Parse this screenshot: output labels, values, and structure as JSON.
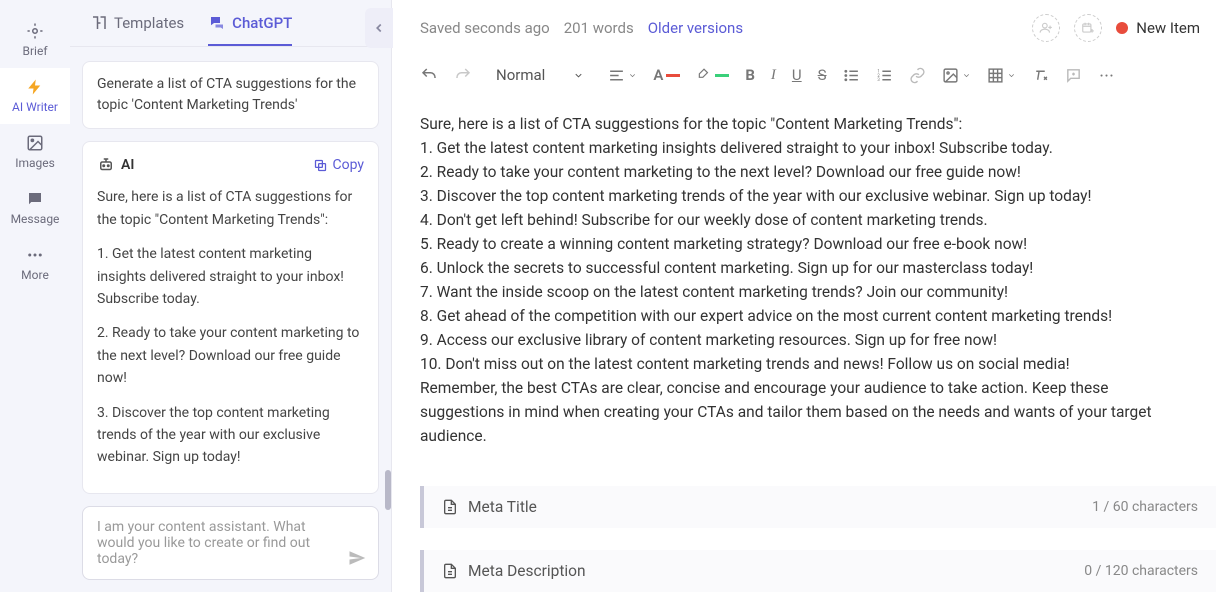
{
  "nav": {
    "brief": "Brief",
    "ai_writer": "AI Writer",
    "images": "Images",
    "message": "Message",
    "more": "More"
  },
  "ai_panel": {
    "tab_templates": "Templates",
    "tab_chatgpt": "ChatGPT",
    "user_message": "Generate a list of CTA suggestions for the topic 'Content Marketing Trends'",
    "ai_label": "AI",
    "copy_label": "Copy",
    "ai_intro": "Sure, here is a list of CTA suggestions for the topic \"Content Marketing Trends\":",
    "ai_item1": "1. Get the latest content marketing insights delivered straight to your inbox! Subscribe today.",
    "ai_item2": "2. Ready to take your content marketing to the next level? Download our free guide now!",
    "ai_item3": "3. Discover the top content marketing trends of the year with our exclusive webinar. Sign up today!",
    "input_placeholder": "I am your content assistant. What would you like to create or find out today?"
  },
  "header": {
    "saved": "Saved seconds ago",
    "wordcount": "201 words",
    "older_versions": "Older versions",
    "new_item": "New Item"
  },
  "toolbar": {
    "style_label": "Normal"
  },
  "document": {
    "intro": "Sure, here is a list of CTA suggestions for the topic \"Content Marketing Trends\":",
    "l1": "1. Get the latest content marketing insights delivered straight to your inbox! Subscribe today.",
    "l2": "2. Ready to take your content marketing to the next level? Download our free guide now!",
    "l3": "3. Discover the top content marketing trends of the year with our exclusive webinar. Sign up today!",
    "l4": "4. Don't get left behind! Subscribe for our weekly dose of content marketing trends.",
    "l5": "5. Ready to create a winning content marketing strategy? Download our free e-book now!",
    "l6": "6. Unlock the secrets to successful content marketing. Sign up for our masterclass today!",
    "l7": "7. Want the inside scoop on the latest content marketing trends? Join our community!",
    "l8": "8. Get ahead of the competition with our expert advice on the most current content marketing trends!",
    "l9": "9. Access our exclusive library of content marketing resources. Sign up for free now!",
    "l10": "10. Don't miss out on the latest content marketing trends and news! Follow us on social media!",
    "outro": "Remember, the best CTAs are clear, concise and encourage your audience to take action. Keep these suggestions in mind when creating your CTAs and tailor them based on the needs and wants of your target audience."
  },
  "meta_title": {
    "label": "Meta Title",
    "counter": "1 / 60 characters"
  },
  "meta_desc": {
    "label": "Meta Description",
    "counter": "0 / 120 characters"
  }
}
